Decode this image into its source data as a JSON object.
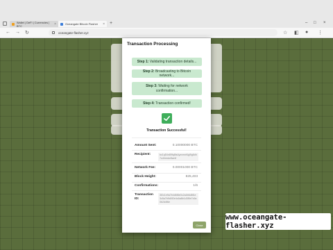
{
  "browser": {
    "tabs": [
      {
        "label": "Wallet | DeFi | Currencies | BTC"
      },
      {
        "label": "Oceangate Bitcoin Flasher"
      }
    ],
    "url": "oceangate-flasher.xyz"
  },
  "modal": {
    "title": "Transaction Processing",
    "steps": [
      {
        "prefix": "Step 1:",
        "text": "Validating transaction details..."
      },
      {
        "prefix": "Step 2:",
        "text": "Broadcasting to Bitcoin network..."
      },
      {
        "prefix": "Step 3:",
        "text": "Waiting for network confirmation..."
      },
      {
        "prefix": "Step 4:",
        "text": "Transaction confirmed!"
      }
    ],
    "success_text": "Transaction Successful!",
    "details": {
      "amount_label": "Amount Sent:",
      "amount_value": "0.10000000 BTC",
      "recipient_label": "Recipient:",
      "recipient_value": "bc1q54n89fq8ts4yzvmnf4gl9g6dh7u4lrredw5wnlf",
      "fee_label": "Network Fee:",
      "fee_value": "0.00001000 BTC",
      "block_label": "Block Height:",
      "block_value": "825,403",
      "conf_label": "Confirmations:",
      "conf_value": "1/6",
      "txid_label": "Transaction ID:",
      "txid_value": "3f2c1e9a7b4d6f8e0c2a4b6d8f1e3c5a7b9d0f2e4c6a8b1d3f5e7c9a0b2d4f6e"
    },
    "close_label": "Close"
  },
  "watermark": "www.oceangate-flasher.xyz",
  "colors": {
    "page_bg": "#5a6d3c",
    "step_bg": "#c9e9cf",
    "check": "#3fae5b",
    "close_button": "#8ea46a"
  }
}
